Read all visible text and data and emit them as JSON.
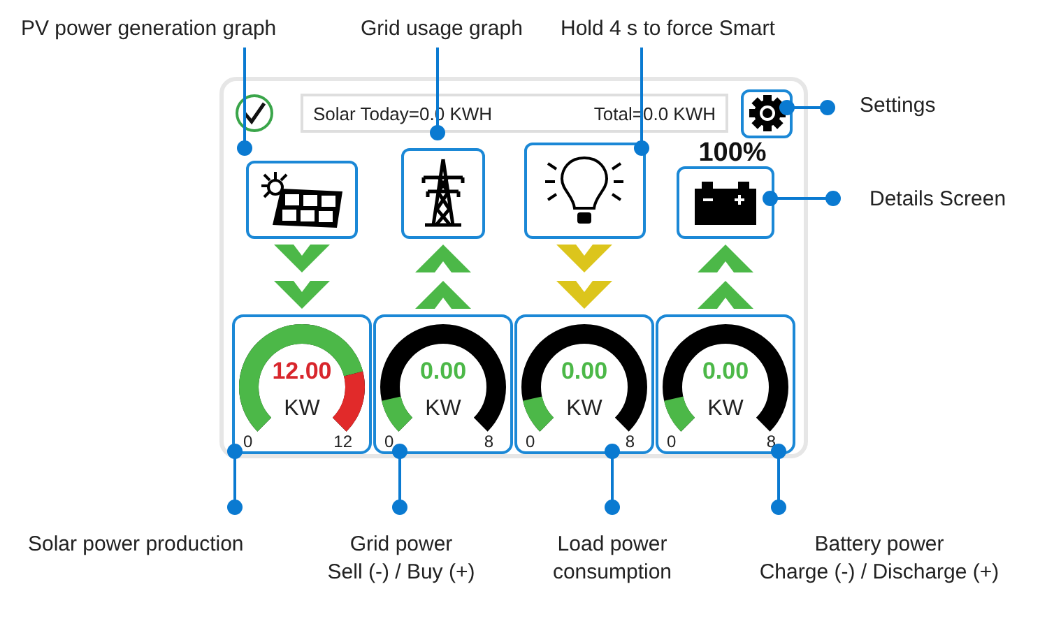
{
  "annotations": [
    {
      "lines": [
        "PV power generation graph"
      ]
    },
    {
      "lines": [
        "Grid usage graph"
      ]
    },
    {
      "lines": [
        "Hold 4 s to force Smart"
      ]
    },
    {
      "lines": [
        "Settings"
      ]
    },
    {
      "lines": [
        "Details Screen"
      ]
    },
    {
      "lines": [
        "Solar power production"
      ]
    },
    {
      "lines": [
        "Grid power",
        "Sell (-) / Buy (+)"
      ]
    },
    {
      "lines": [
        "Load power",
        "consumption"
      ]
    },
    {
      "lines": [
        "Battery power",
        "Charge (-) / Discharge (+)"
      ]
    }
  ],
  "summary": {
    "today": "Solar Today=0.0 KWH",
    "total": "Total=0.0 KWH"
  },
  "devices": [
    {
      "kind": "solar"
    },
    {
      "kind": "grid"
    },
    {
      "kind": "load"
    },
    {
      "kind": "battery",
      "percent": "100%"
    }
  ],
  "flows": [
    {
      "kind": "down",
      "color": "#4cb848"
    },
    {
      "kind": "up",
      "color": "#4cb848"
    },
    {
      "kind": "down",
      "color": "#dcc51c"
    },
    {
      "kind": "up",
      "color": "#4cb848"
    }
  ],
  "gauges": [
    {
      "value": "12.00",
      "unit": "KW",
      "min": "0",
      "max": "12",
      "over_limit": true
    },
    {
      "value": "0.00",
      "unit": "KW",
      "min": "0",
      "max": "8",
      "over_limit": false
    },
    {
      "value": "0.00",
      "unit": "KW",
      "min": "0",
      "max": "8",
      "over_limit": false
    },
    {
      "value": "0.00",
      "unit": "KW",
      "min": "0",
      "max": "8",
      "over_limit": false
    }
  ]
}
